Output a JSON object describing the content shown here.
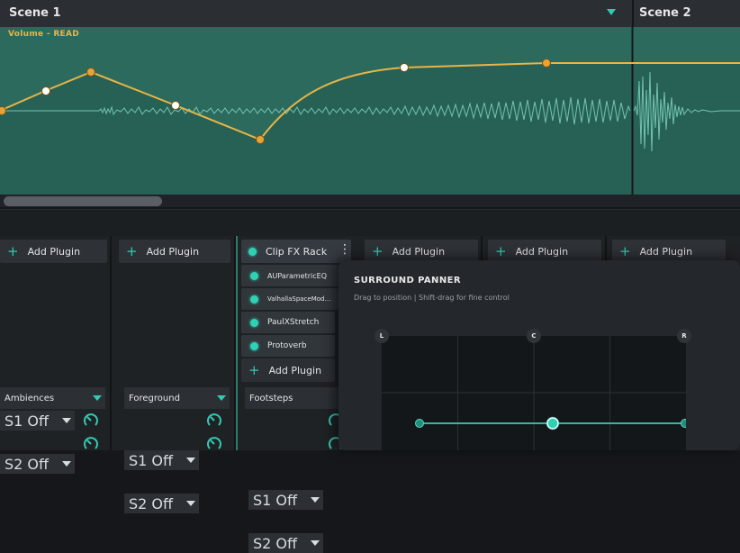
{
  "scenes": {
    "scene1": {
      "label": "Scene 1"
    },
    "scene2": {
      "label": "Scene 2"
    }
  },
  "lane": {
    "label": "Volume - READ",
    "colors": {
      "lane_bg": "#2c6a5e",
      "automation": "#e8b544",
      "waveform": "#7fd6bf"
    }
  },
  "channels": [
    {
      "add_plugin": "Add Plugin",
      "name": "Ambiences",
      "sends": [
        {
          "label": "S1 Off"
        },
        {
          "label": "S2 Off"
        }
      ]
    },
    {
      "add_plugin": "Add Plugin",
      "name": "Foreground",
      "sends": [
        {
          "label": "S1 Off"
        },
        {
          "label": "S2 Off"
        }
      ]
    },
    {
      "rack": "Clip FX Rack",
      "plugins": [
        "AUParametricEQ",
        "ValhallaSpaceMod…",
        "PaulXStretch",
        "Protoverb"
      ],
      "add_plugin": "Add Plugin",
      "name": "Footsteps",
      "sends": [
        {
          "label": "S1 Off"
        },
        {
          "label": "S2 Off"
        }
      ]
    },
    {
      "add_plugin": "Add Plugin"
    },
    {
      "add_plugin": "Add Plugin"
    },
    {
      "add_plugin": "Add Plugin"
    }
  ],
  "panner": {
    "title": "SURROUND PANNER",
    "subtitle": "Drag to position  |  Shift-drag for fine control",
    "speakers": {
      "left": "L",
      "center": "C",
      "right": "R"
    }
  },
  "accent_color": "#33c9b3"
}
